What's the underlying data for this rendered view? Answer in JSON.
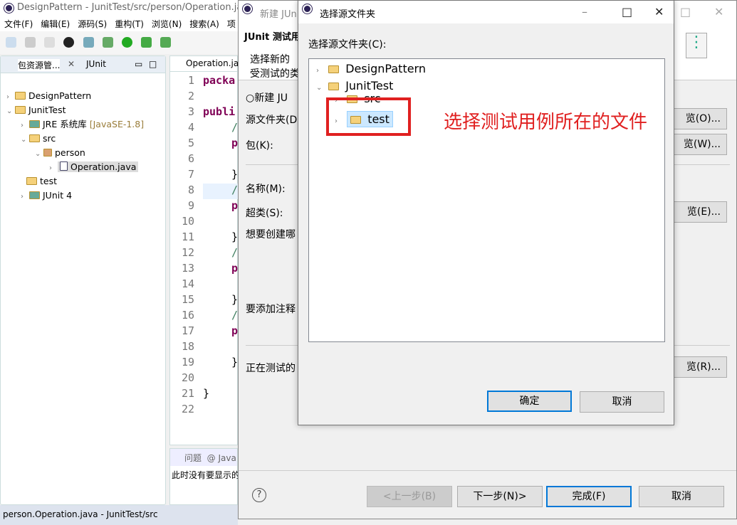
{
  "main_window": {
    "title": "DesignPattern - JunitTest/src/person/Operation.java -",
    "menu": [
      "文件(F)",
      "编辑(E)",
      "源码(S)",
      "重构(T)",
      "浏览(N)",
      "搜索(A)",
      "项"
    ],
    "left_panel": {
      "tabs": [
        "包资源管...",
        "JUnit"
      ],
      "tree": [
        {
          "label": "DesignPattern",
          "expanded": false
        },
        {
          "label": "JunitTest",
          "expanded": true
        },
        {
          "label": "JRE 系统库",
          "decoration": "[JavaSE-1.8]"
        },
        {
          "label": "src",
          "expanded": true
        },
        {
          "label": "person",
          "expanded": true
        },
        {
          "label": "Operation.java",
          "selected": true
        },
        {
          "label": "test"
        },
        {
          "label": "JUnit 4"
        }
      ]
    },
    "editor": {
      "tab": "Operation.java",
      "line_numbers": [
        "1",
        "2",
        "3",
        "4",
        "5",
        "6",
        "7",
        "8",
        "9",
        "10",
        "11",
        "12",
        "13",
        "14",
        "15",
        "16",
        "17",
        "18",
        "19",
        "20",
        "21",
        "22"
      ],
      "code": {
        "1": "packa",
        "3": "publi",
        "4": "/",
        "5": "p",
        "7": "}",
        "8": "/",
        "9": "p",
        "11": "}",
        "12": "/",
        "13": "p",
        "15": "}",
        "16": "/",
        "17": "p",
        "19": "}",
        "21": "}"
      }
    },
    "bottom_panel": {
      "tabs": [
        "问题",
        "Java"
      ],
      "message": "此时没有要显示的"
    },
    "status": "person.Operation.java - JunitTest/src"
  },
  "wizard": {
    "title": "新建 JUnit",
    "header_title": "JUnit 测试用",
    "header_desc": [
      "选择新的",
      "受测试的类"
    ],
    "radio_new": "新建 JU",
    "labels": {
      "source_folder": "源文件夹(D",
      "package": "包(K):",
      "name": "名称(M):",
      "superclass": "超类(S):",
      "stubs": "想要创建哪",
      "annotations": "要添加注释",
      "class_under_test": "正在测试的"
    },
    "browse_buttons": [
      "览(O)...",
      "览(W)...",
      "览(E)...",
      "览(R)..."
    ],
    "buttons": {
      "back": "<上一步(B)",
      "next": "下一步(N)>",
      "finish": "完成(F)",
      "cancel": "取消"
    }
  },
  "dialog": {
    "title": "选择源文件夹",
    "label": "选择源文件夹(C):",
    "tree": [
      {
        "label": "DesignPattern",
        "expanded": false
      },
      {
        "label": "JunitTest",
        "expanded": true
      },
      {
        "label": "src"
      },
      {
        "label": "test",
        "selected": true
      }
    ],
    "ok": "确定",
    "cancel": "取消"
  },
  "annotation": {
    "text": "选择测试用例所在的文件",
    "color": "#e02020"
  }
}
